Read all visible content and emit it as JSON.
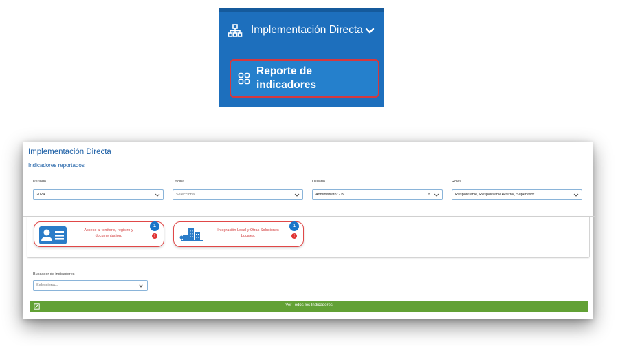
{
  "menu": {
    "section_label": "Implementación Directa",
    "section_icon": "sitemap-icon",
    "chevron_icon": "chevron-down-icon",
    "subitem_label": "Reporte de indicadores",
    "subitem_icon": "grid-icon",
    "highlight_color": "#d6383d",
    "bg_color": "#1d6fbd"
  },
  "page": {
    "title": "Implementación Directa",
    "subtitle": "Indicadores reportados",
    "title_color": "#1c5fa6"
  },
  "filters": [
    {
      "label": "Periodo",
      "value": "2024",
      "has_clear": false
    },
    {
      "label": "Oficina",
      "placeholder": "Selecciona...",
      "has_clear": false
    },
    {
      "label": "Usuario",
      "value": "Administrator - BO",
      "has_clear": true
    },
    {
      "label": "Roles",
      "value": "Responsable, Responsable Alterno, Supervisor",
      "has_clear": false
    }
  ],
  "indicator_cards": [
    {
      "text": "Acceso al territorio, registro y documentación.",
      "count": "1",
      "alert": "!",
      "icon": "id-card-icon"
    },
    {
      "text": "Integración Local y Otras Soluciones Locales.",
      "count": "1",
      "alert": "!",
      "icon": "buildings-icon"
    }
  ],
  "search": {
    "label": "Buscador de indicadores",
    "placeholder": "Selecciona..."
  },
  "view_all_button": {
    "label": "Ver Todos los Indicadores",
    "icon": "external-icon",
    "color": "#62a135"
  }
}
